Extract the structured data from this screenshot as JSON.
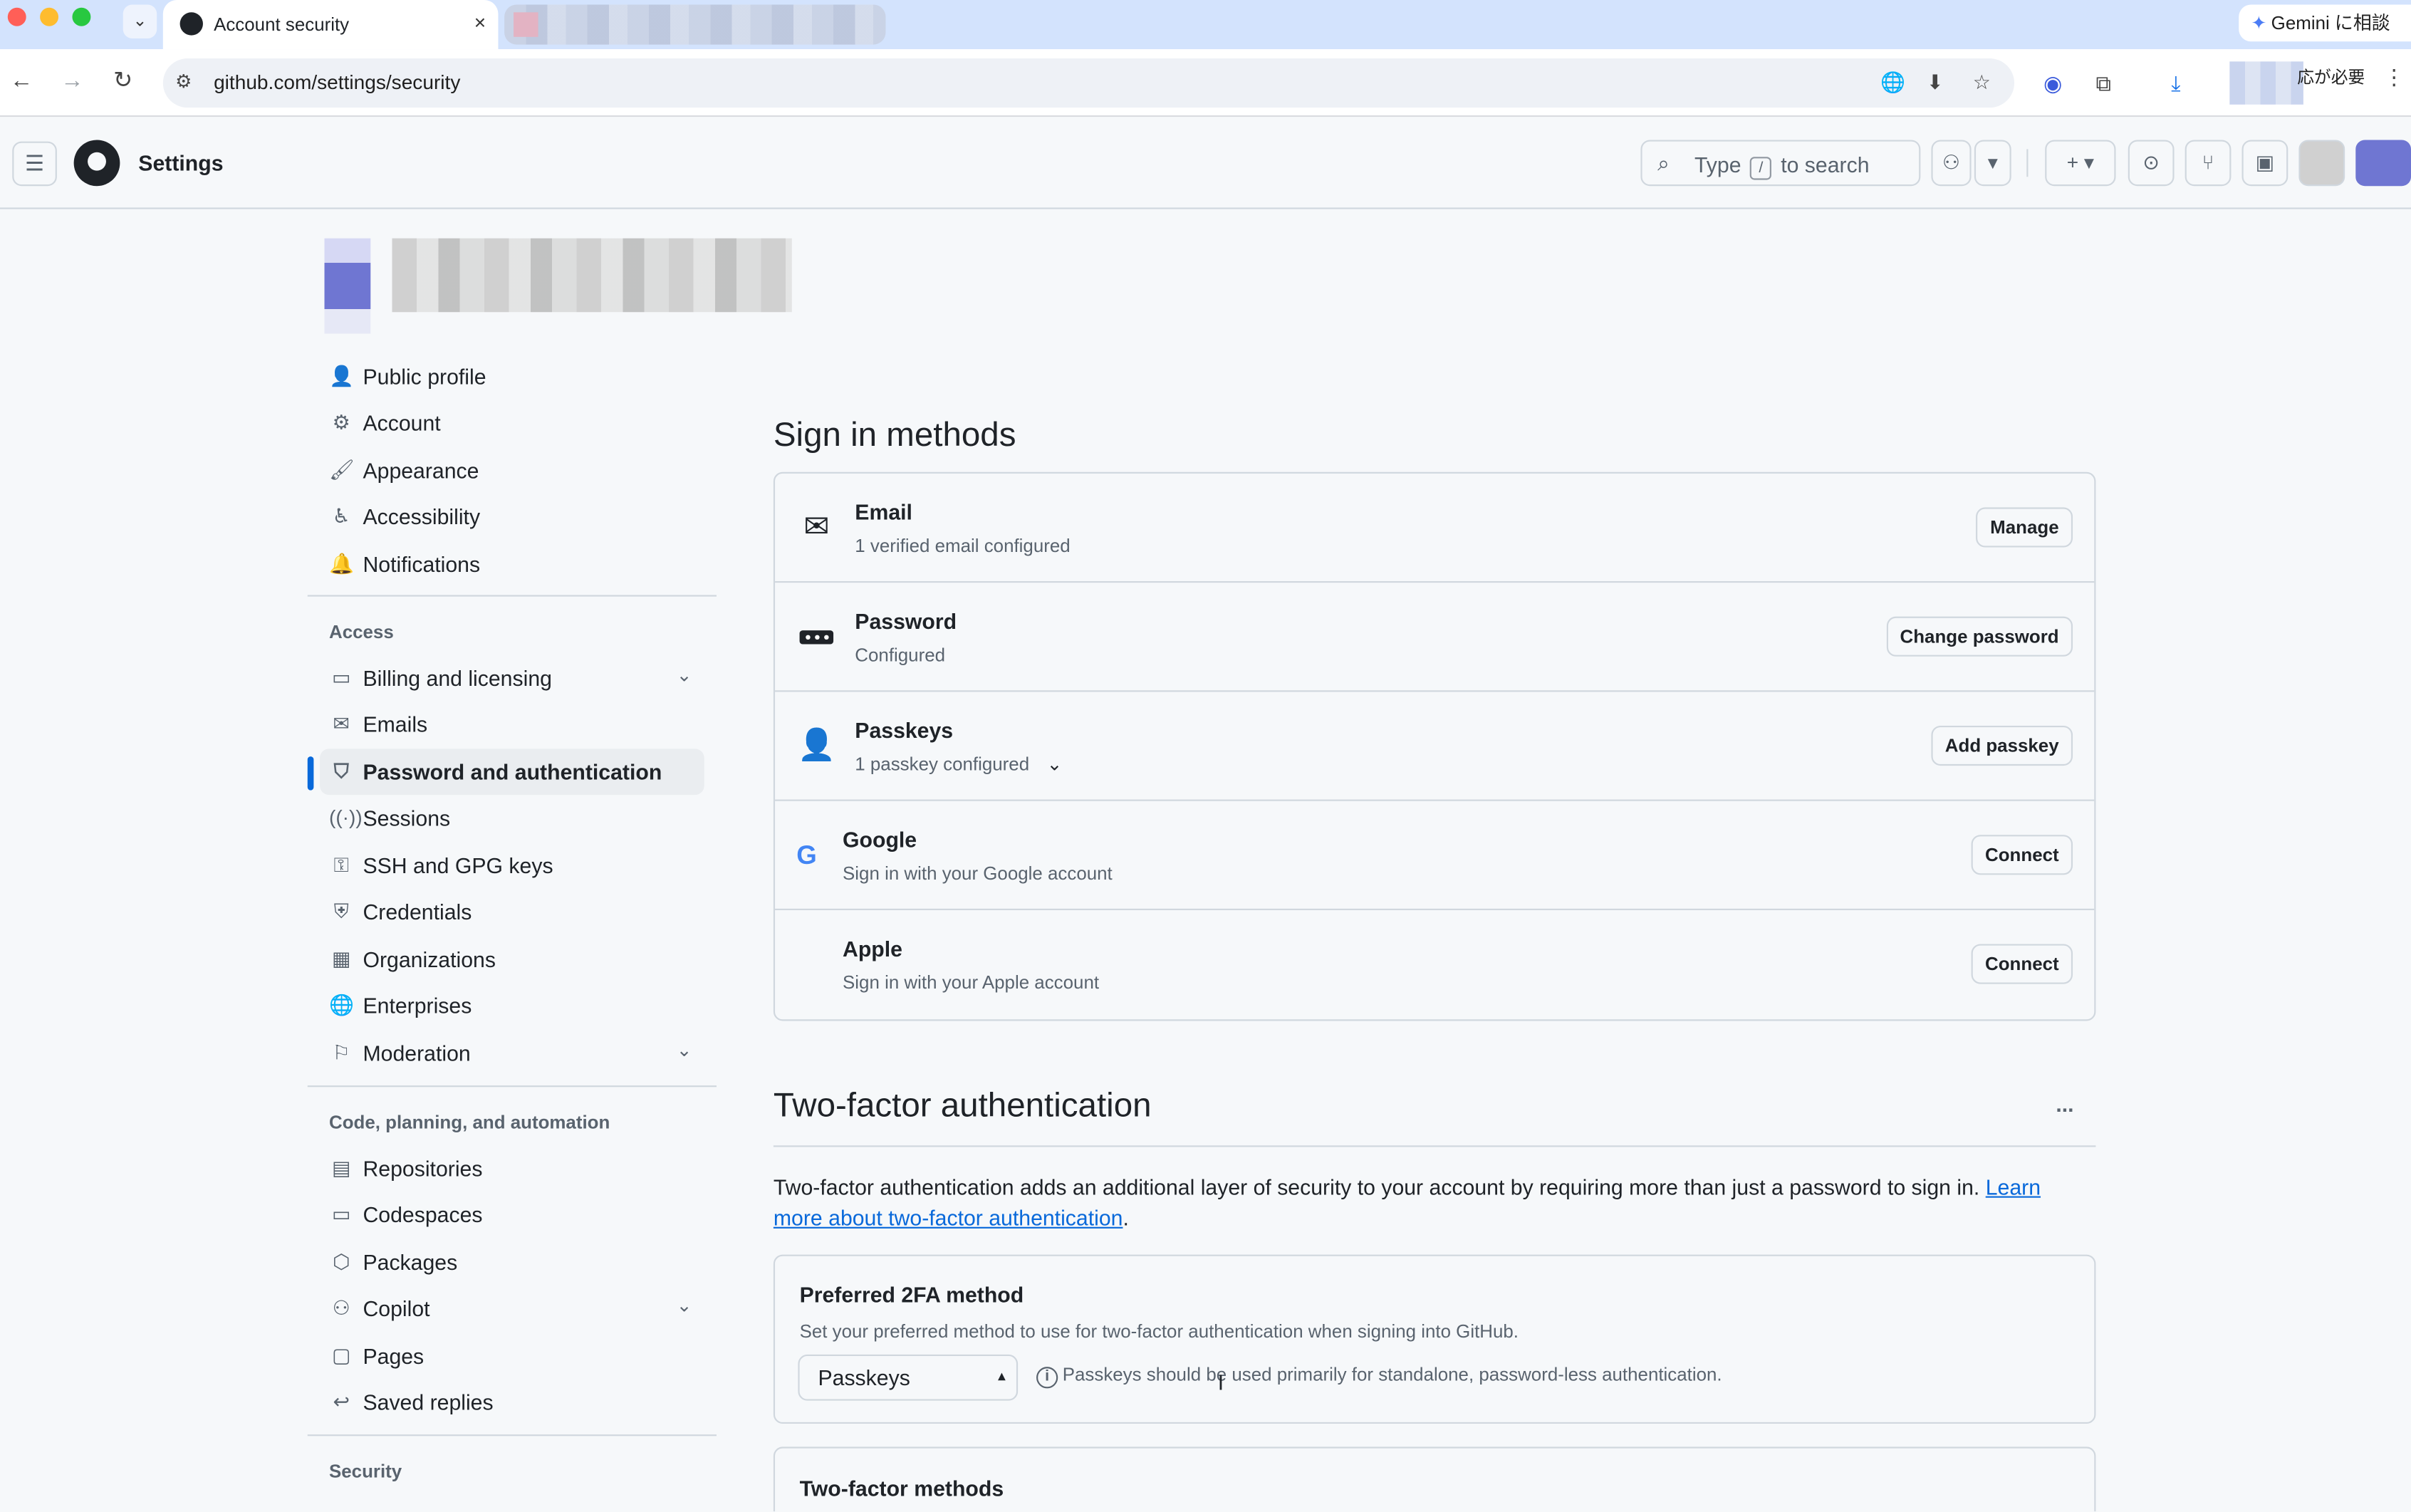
{
  "browser": {
    "tab_title": "Account security",
    "tab_close": "×",
    "tab_menu": "⌄",
    "gemini_label": "Gemini に相談",
    "url": "github.com/settings/security",
    "update_label": "応が必要",
    "icons": [
      "back-icon",
      "forward-icon",
      "reload-icon",
      "site-info-icon",
      "translate-icon",
      "install-icon",
      "bookmark-star-icon",
      "extension-icon",
      "puzzle-icon",
      "download-icon",
      "menu-icon"
    ]
  },
  "header": {
    "title": "Settings",
    "search_prefix": "Type",
    "search_key": "/",
    "search_suffix": "to search"
  },
  "sidebar": {
    "items_top": [
      {
        "label": "Public profile",
        "icon": "person-icon"
      },
      {
        "label": "Account",
        "icon": "gear-icon"
      },
      {
        "label": "Appearance",
        "icon": "paintbrush-icon"
      },
      {
        "label": "Accessibility",
        "icon": "accessibility-icon"
      },
      {
        "label": "Notifications",
        "icon": "bell-icon"
      }
    ],
    "access_heading": "Access",
    "items_access": [
      {
        "label": "Billing and licensing",
        "icon": "credit-card-icon"
      },
      {
        "label": "Emails",
        "icon": "mail-icon"
      },
      {
        "label": "Password and authentication",
        "icon": "shield-lock-icon"
      },
      {
        "label": "Sessions",
        "icon": "broadcast-icon"
      },
      {
        "label": "SSH and GPG keys",
        "icon": "key-icon"
      },
      {
        "label": "Credentials",
        "icon": "shield-check-icon"
      },
      {
        "label": "Organizations",
        "icon": "organization-icon"
      },
      {
        "label": "Enterprises",
        "icon": "globe-icon"
      },
      {
        "label": "Moderation",
        "icon": "report-icon"
      }
    ],
    "code_heading": "Code, planning, and automation",
    "items_code": [
      {
        "label": "Repositories",
        "icon": "repo-icon"
      },
      {
        "label": "Codespaces",
        "icon": "codespaces-icon"
      },
      {
        "label": "Packages",
        "icon": "package-icon"
      },
      {
        "label": "Copilot",
        "icon": "copilot-icon"
      },
      {
        "label": "Pages",
        "icon": "browser-icon"
      },
      {
        "label": "Saved replies",
        "icon": "reply-icon"
      }
    ],
    "security_heading": "Security"
  },
  "signin": {
    "heading": "Sign in methods",
    "rows": [
      {
        "title": "Email",
        "sub": "1 verified email configured",
        "button": "Manage"
      },
      {
        "title": "Password",
        "sub": "Configured",
        "button": "Change password"
      },
      {
        "title": "Passkeys",
        "sub": "1 passkey configured",
        "button": "Add passkey"
      },
      {
        "title": "Google",
        "sub": "Sign in with your Google account",
        "button": "Connect"
      },
      {
        "title": "Apple",
        "sub": "Sign in with your Apple account",
        "button": "Connect"
      }
    ]
  },
  "twofa": {
    "heading": "Two-factor authentication",
    "more": "...",
    "desc": "Two-factor authentication adds an additional layer of security to your account by requiring more than just a password to sign in.",
    "link": "Learn more about two-factor authentication",
    "period": ".",
    "pref_title": "Preferred 2FA method",
    "pref_sub": "Set your preferred method to use for two-factor authentication when signing into GitHub.",
    "pref_value": "Passkeys",
    "pref_note": "Passkeys should be used primarily for standalone, password-less authentication.",
    "methods_title": "Two-factor methods"
  }
}
